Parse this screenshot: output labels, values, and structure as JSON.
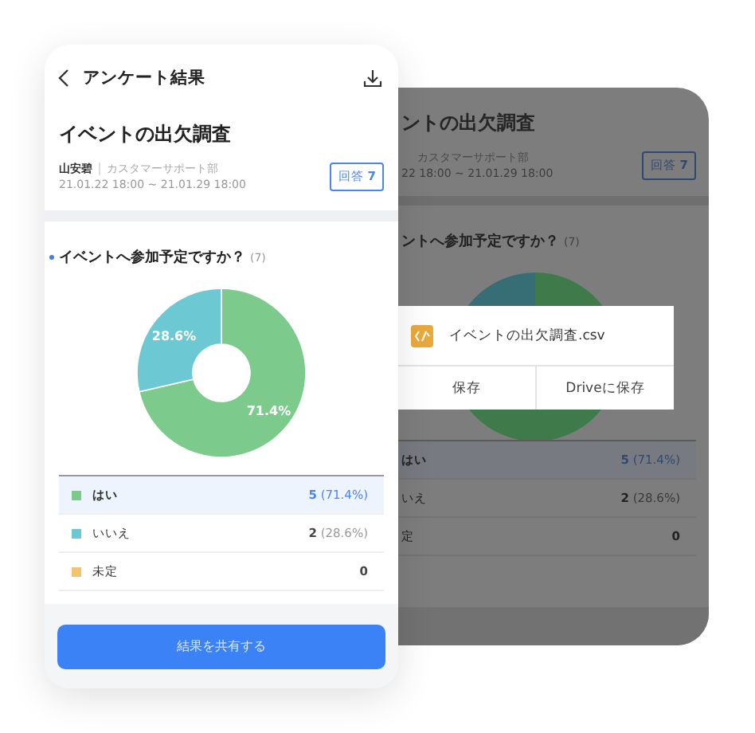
{
  "left_screen": {
    "header": {
      "title": "アンケート結果"
    },
    "survey": {
      "title": "イベントの出欠調査",
      "author": "山安碧",
      "department": "カスタマーサポート部",
      "period": "21.01.22 18:00 ~ 21.01.29 18:00",
      "responses_button": "回答 **7**"
    },
    "question": {
      "text": "イベントへ参加予定ですか？",
      "count": "(7)",
      "chart_data": {
        "type": "donut",
        "series": [
          {
            "values": [
              71.4,
              28.6,
              0
            ]
          }
        ],
        "value_labels": [
          "71.4%",
          "28.6%",
          null
        ]
      }
    },
    "answers": [
      {
        "label": "はい",
        "color": "#7dcb8c",
        "count": "5",
        "percent": "(71.4%)",
        "selected": true
      },
      {
        "label": "いいえ",
        "color": "#6cc9d4",
        "count": "2",
        "percent": "(28.6%)",
        "selected": false
      },
      {
        "label": "未定",
        "color": "#f3c46f",
        "count": "0",
        "selected": false
      }
    ],
    "share_button": "結果を共有する"
  },
  "right_screen": {
    "survey": {
      "title": "ントの出欠調査",
      "department": "カスタマーサポート部",
      "period": "22 18:00 ~ 21.01.29 18:00",
      "responses_button": "回答 **7**"
    },
    "question": {
      "text": "ントへ参加予定ですか？",
      "count": "(7)"
    },
    "export_dialog": {
      "file_name": "イベントの出欠調査.csv",
      "actions": [
        "保存",
        "Driveに保存"
      ]
    },
    "answers": [
      {
        "label": "はい",
        "count": "5",
        "percent": "(71.4%)",
        "selected": true
      },
      {
        "label": "いえ",
        "count": "2",
        "percent": "(28.6%)",
        "selected": false
      },
      {
        "label": "定",
        "count": "0",
        "selected": false
      }
    ]
  }
}
